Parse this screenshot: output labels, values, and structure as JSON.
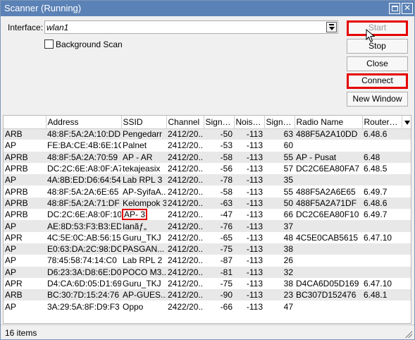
{
  "window": {
    "title": "Scanner (Running)"
  },
  "interface": {
    "label": "Interface:",
    "value": "wlan1"
  },
  "background_scan": {
    "label": "Background Scan",
    "checked": false
  },
  "buttons": {
    "start": "Start",
    "stop": "Stop",
    "close": "Close",
    "connect": "Connect",
    "new_window": "New Window"
  },
  "table": {
    "headers": [
      "",
      "Address",
      "SSID",
      "Channel",
      "Signal...",
      "Noise ...",
      "Signal...",
      "Radio Name",
      "RouterO...",
      ""
    ],
    "rows": [
      [
        "ARB",
        "48:8F:5A:2A:10:DD",
        "Pengedarr",
        "2412/20...",
        "-50",
        "-113",
        "63",
        "488F5A2A10DD",
        "6.48.6"
      ],
      [
        "AP",
        "FE:BA:CE:4B:6E:1C",
        "Palnet",
        "2412/20...",
        "-53",
        "-113",
        "60",
        "",
        ""
      ],
      [
        "APRB",
        "48:8F:5A:2A:70:59",
        "AP - AR",
        "2412/20...",
        "-58",
        "-113",
        "55",
        "AP - Pusat",
        "6.48"
      ],
      [
        "APRB",
        "DC:2C:6E:A8:0F:A7",
        "tekajeasix",
        "2412/20...",
        "-56",
        "-113",
        "57",
        "DC2C6EA80FA7",
        "6.48.5"
      ],
      [
        "AP",
        "4A:8B:ED:D6:64:54",
        "Lab RPL 3",
        "2412/20...",
        "-78",
        "-113",
        "35",
        "",
        ""
      ],
      [
        "APRB",
        "48:8F:5A:2A:6E:65",
        "AP-SyifaA...",
        "2412/20...",
        "-58",
        "-113",
        "55",
        "488F5A2A6E65",
        "6.49.7"
      ],
      [
        "APRB",
        "48:8F:5A:2A:71:DF",
        "Kelompok 3",
        "2412/20...",
        "-63",
        "-113",
        "50",
        "488F5A2A71DF",
        "6.48.6"
      ],
      [
        "APRB",
        "DC:2C:6E:A8:0F:10",
        "AP- 3",
        "2412/20...",
        "-47",
        "-113",
        "66",
        "DC2C6EA80F10",
        "6.49.7"
      ],
      [
        "AP",
        "AE:8D:53:F3:B3:ED",
        "Ianãƒ„",
        "2412/20...",
        "-76",
        "-113",
        "37",
        "",
        ""
      ],
      [
        "APR",
        "4C:5E:0C:AB:56:15",
        "Guru_TKJ",
        "2412/20...",
        "-65",
        "-113",
        "48",
        "4C5E0CAB5615",
        "6.47.10"
      ],
      [
        "AP",
        "E0:63:DA:2C:98:DC",
        "PASGAN...",
        "2412/20...",
        "-75",
        "-113",
        "38",
        "",
        ""
      ],
      [
        "AP",
        "78:45:58:74:14:C0",
        "Lab RPL 2",
        "2412/20...",
        "-87",
        "-113",
        "26",
        "",
        ""
      ],
      [
        "AP",
        "D6:23:3A:D8:6E:D0",
        "POCO M3...",
        "2412/20...",
        "-81",
        "-113",
        "32",
        "",
        ""
      ],
      [
        "APR",
        "D4:CA:6D:05:D1:69",
        "Guru_TKJ",
        "2412/20...",
        "-75",
        "-113",
        "38",
        "D4CA6D05D169",
        "6.47.10"
      ],
      [
        "ARB",
        "BC:30:7D:15:24:76",
        "AP-GUES...",
        "2412/20...",
        "-90",
        "-113",
        "23",
        "BC307D152476",
        "6.48.1"
      ],
      [
        "AP",
        "3A:29:5A:8F:D9:F3",
        "Oppo",
        "2422/20...",
        "-66",
        "-113",
        "47",
        "",
        ""
      ]
    ],
    "highlighted_ssid": "AP- 3"
  },
  "status": {
    "item_count": "16 items"
  },
  "colors": {
    "highlight": "#e60000",
    "titlebar": "#5b82b6"
  }
}
